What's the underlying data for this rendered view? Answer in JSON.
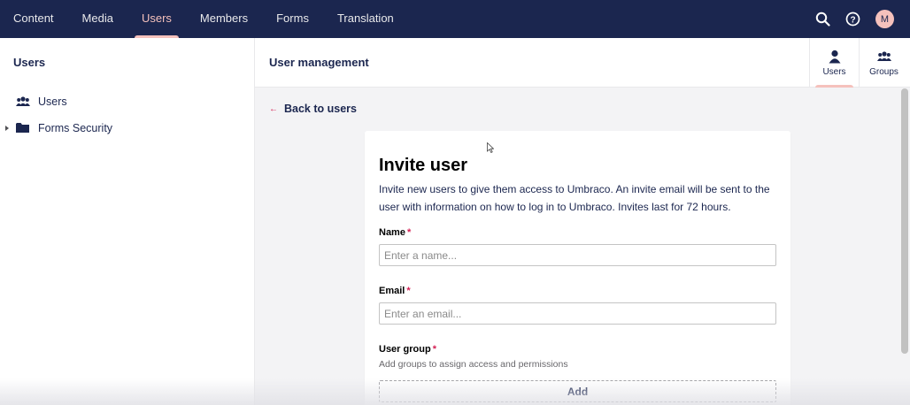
{
  "topnav": {
    "items": [
      {
        "label": "Content"
      },
      {
        "label": "Media"
      },
      {
        "label": "Users",
        "active": true
      },
      {
        "label": "Members"
      },
      {
        "label": "Forms"
      },
      {
        "label": "Translation"
      }
    ],
    "icons": [
      "search-icon",
      "help-icon"
    ],
    "avatar_initial": "M"
  },
  "sidebar": {
    "title": "Users",
    "items": [
      {
        "label": "Users",
        "icon": "users-icon"
      },
      {
        "label": "Forms Security",
        "icon": "folder-icon",
        "expandable": true
      }
    ]
  },
  "header": {
    "title": "User management",
    "tabs": [
      {
        "label": "Users",
        "icon": "user-icon",
        "active": true
      },
      {
        "label": "Groups",
        "icon": "users-icon"
      }
    ]
  },
  "back_link": {
    "arrow": "←",
    "label": "Back to users"
  },
  "invite_form": {
    "title": "Invite user",
    "description": "Invite new users to give them access to Umbraco. An invite email will be sent to the user with information on how to log in to Umbraco. Invites last for 72 hours.",
    "name": {
      "label": "Name",
      "required_mark": "*",
      "placeholder": "Enter a name...",
      "value": ""
    },
    "email": {
      "label": "Email",
      "required_mark": "*",
      "placeholder": "Enter an email...",
      "value": ""
    },
    "user_group": {
      "label": "User group",
      "required_mark": "*",
      "help": "Add groups to assign access and permissions"
    },
    "add_button_label": "Add"
  },
  "colors": {
    "nav_bg": "#1b264f",
    "accent": "#f5c1bc",
    "required": "#d42054",
    "text": "#1b264f"
  }
}
